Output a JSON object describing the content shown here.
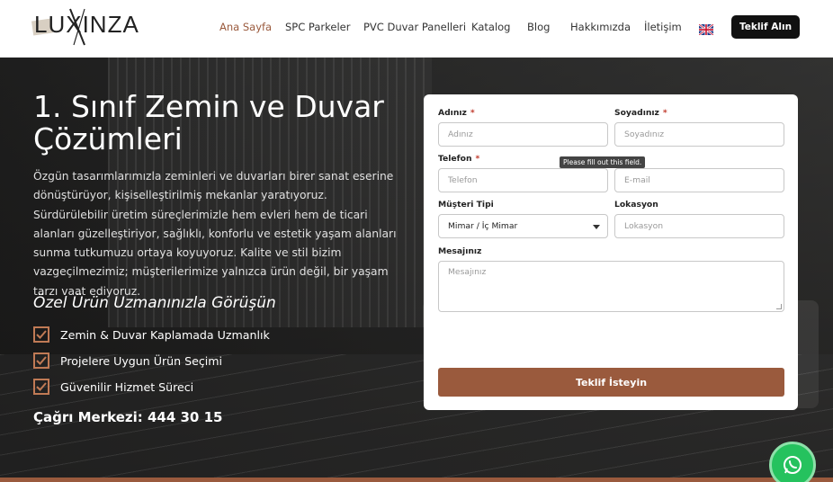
{
  "brand": {
    "logo_text": "LUXINZA"
  },
  "nav": {
    "items": [
      {
        "label": "Ana Sayfa",
        "active": true
      },
      {
        "label": "SPC Parkeler"
      },
      {
        "label": "PVC Duvar Panelleri"
      },
      {
        "label": "Katalog"
      },
      {
        "label": "Blog"
      },
      {
        "label": "Hakkımızda"
      },
      {
        "label": "İletişim"
      }
    ],
    "language_icon": "uk-flag-icon",
    "cta_label": "Teklif Alın"
  },
  "hero": {
    "title": "1. Sınıf Zemin ve Duvar Çözümleri",
    "description": "Özgün tasarımlarımızla zeminleri ve duvarları birer sanat eserine dönüştürüyor, kişiselleştirilmiş mekanlar yaratıyoruz. Sürdürülebilir üretim süreçlerimizle hem evleri hem de ticari alanları güzelleştiriyor, sağlıklı, konforlu ve estetik yaşam alanları sunma tutkumuzu ortaya koyuyoruz. Kalite ve stil bizim vazgeçilmezimiz; müşterilerimize yalnızca ürün değil, bir yaşam tarzı vaat ediyoruz.",
    "subtitle": "Özel Ürün Uzmanınızla Görüşün",
    "features": [
      "Zemin & Duvar Kaplamada Uzmanlık",
      "Projelere Uygun Ürün Seçimi",
      "Güvenilir Hizmet Süreci"
    ],
    "call_center": "Çağrı Merkezi: 444 30 15"
  },
  "form": {
    "first_name": {
      "label": "Adınız",
      "required": "*",
      "placeholder": "Adınız"
    },
    "last_name": {
      "label": "Soyadınız",
      "required": "*",
      "placeholder": "Soyadınız"
    },
    "phone": {
      "label": "Telefon",
      "required": "*",
      "placeholder": "Telefon"
    },
    "email": {
      "placeholder": "E-mail"
    },
    "customer_type": {
      "label": "Müşteri Tipi",
      "value": "Mimar / İç Mimar"
    },
    "location": {
      "label": "Lokasyon",
      "placeholder": "Lokasyon"
    },
    "message": {
      "label": "Mesajınız",
      "placeholder": "Mesajınız"
    },
    "tooltip": "Please fill out this field.",
    "submit_label": "Teklif İsteyin"
  },
  "colors": {
    "accent": "#9a5a3d",
    "whatsapp": "#25c25e"
  },
  "whatsapp_icon": "whatsapp-icon"
}
